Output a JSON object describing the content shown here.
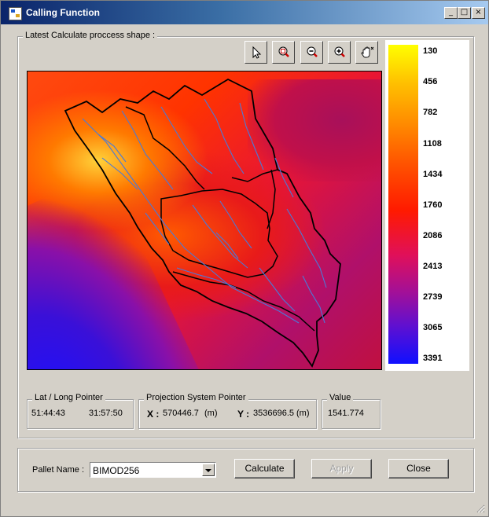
{
  "window": {
    "title": "Calling Function",
    "minimize": "_",
    "maximize": "□",
    "close": "×"
  },
  "shape_group": {
    "label": "Latest Calculate proccess shape :"
  },
  "toolbar": {
    "tools": [
      {
        "name": "pointer-tool-button",
        "icon": "arrow-pointer-icon"
      },
      {
        "name": "zoom-extent-button",
        "icon": "zoom-extent-icon"
      },
      {
        "name": "zoom-out-button",
        "icon": "zoom-out-icon"
      },
      {
        "name": "zoom-in-button",
        "icon": "zoom-in-icon"
      },
      {
        "name": "pan-button",
        "icon": "hand-pan-icon"
      }
    ]
  },
  "legend": {
    "values": [
      "130",
      "456",
      "782",
      "1108",
      "1434",
      "1760",
      "2086",
      "2413",
      "2739",
      "3065",
      "3391"
    ],
    "colors": [
      "#ffff00",
      "#1010ff"
    ]
  },
  "latlong": {
    "label": "Lat / Long Pointer",
    "lat": "51:44:43",
    "long": "31:57:50"
  },
  "projection": {
    "label": "Projection System Pointer",
    "x_label": "X :",
    "x_value": "570446.7",
    "x_unit": "(m)",
    "y_label": "Y :",
    "y_value": "3536696.5",
    "y_unit": "(m)"
  },
  "value_box": {
    "label": "Value",
    "value": "1541.774"
  },
  "pallet": {
    "label": "Pallet Name :",
    "selected": "BIMOD256"
  },
  "buttons": {
    "calculate": "Calculate",
    "apply": "Apply",
    "close": "Close"
  }
}
